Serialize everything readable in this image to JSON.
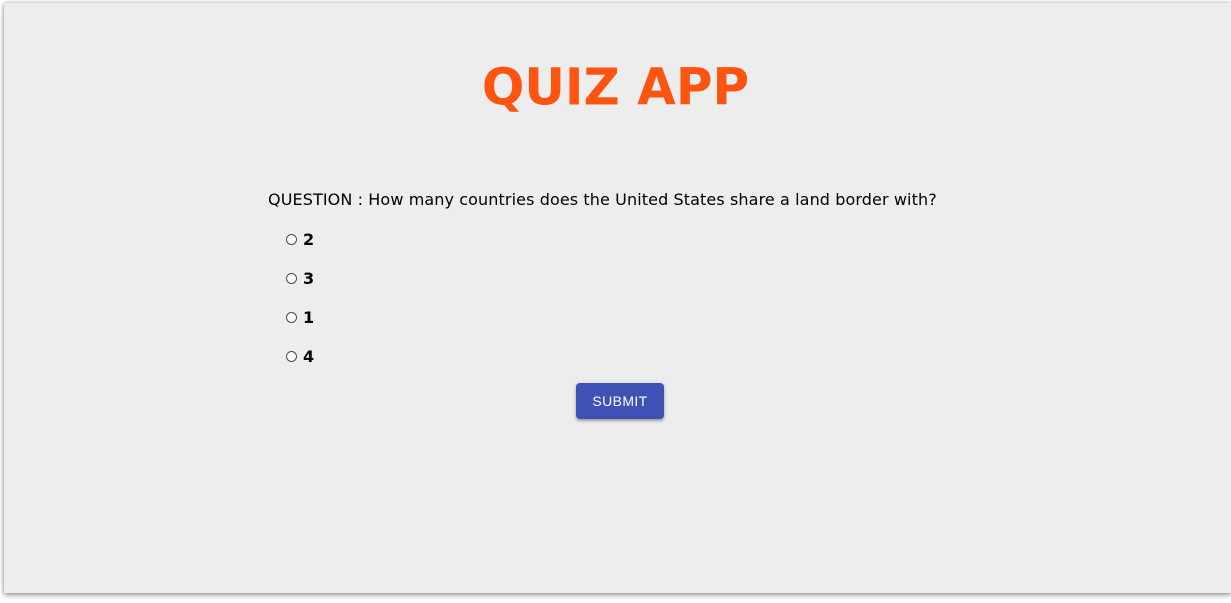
{
  "app": {
    "title": "QUIZ APP",
    "title_color": "#ff5511"
  },
  "quiz": {
    "question_prefix": "QUESTION : ",
    "question_text": "How many countries does the United States share a land border with?",
    "options": [
      {
        "label": "2",
        "selected": false
      },
      {
        "label": "3",
        "selected": false
      },
      {
        "label": "1",
        "selected": false
      },
      {
        "label": "4",
        "selected": false
      }
    ],
    "submit_label": "SUBMIT",
    "submit_color": "#3f51b5"
  }
}
